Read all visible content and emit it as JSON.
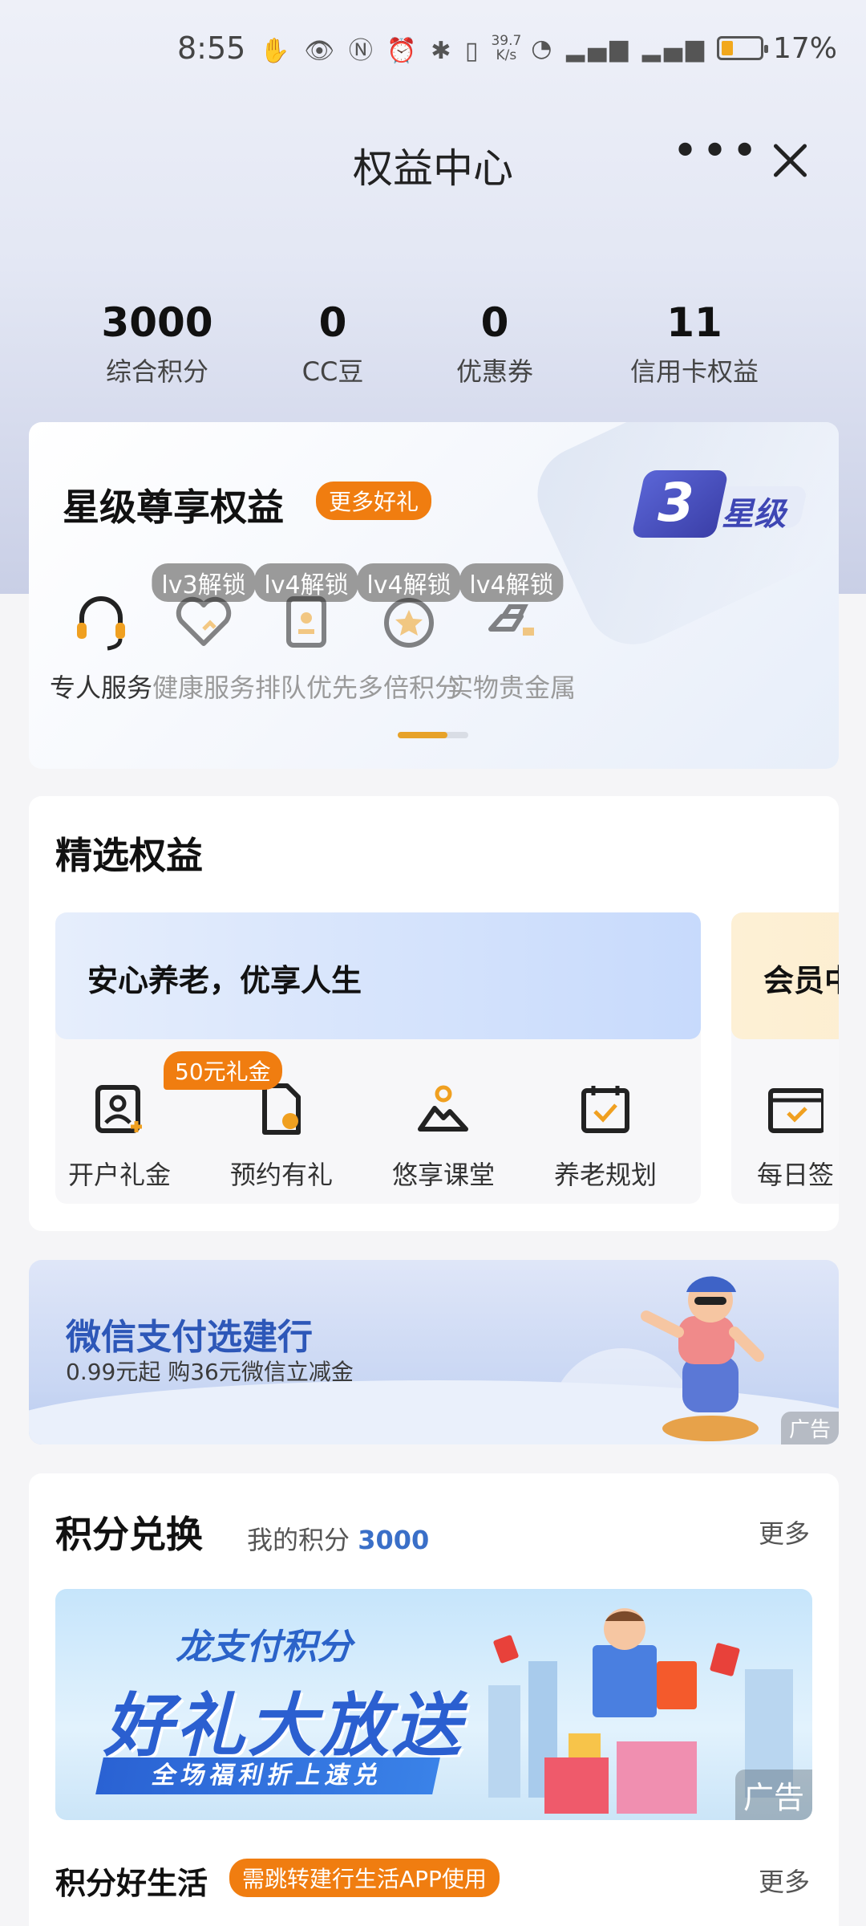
{
  "status_bar": {
    "time": "8:55",
    "net_speed_top": "39.7",
    "net_speed_bottom": "K/s",
    "battery": "17%",
    "battery_level": 0.17
  },
  "nav": {
    "title": "权益中心",
    "more": "•••"
  },
  "stats": [
    {
      "value": "3000",
      "label": "综合积分"
    },
    {
      "value": "0",
      "label": "CC豆"
    },
    {
      "value": "0",
      "label": "优惠券"
    },
    {
      "value": "11",
      "label": "信用卡权益"
    }
  ],
  "star": {
    "title": "星级尊享权益",
    "more_tag": "更多好礼",
    "level_num": "3",
    "level_text": "星级",
    "benefits": [
      {
        "label": "专人服务",
        "lock": ""
      },
      {
        "label": "健康服务",
        "lock": "lv3解锁"
      },
      {
        "label": "排队优先",
        "lock": "lv4解锁"
      },
      {
        "label": "多倍积分",
        "lock": "lv4解锁"
      },
      {
        "label": "实物贵金属",
        "lock": "lv4解锁"
      }
    ]
  },
  "featured": {
    "title": "精选权益",
    "panel1": {
      "heading": "安心养老，优享人生",
      "badge": "50元礼金",
      "items": [
        "开户礼金",
        "预约有礼",
        "悠享课堂",
        "养老规划"
      ]
    },
    "panel2": {
      "heading": "会员中",
      "items": [
        "每日签"
      ]
    }
  },
  "ad_banner": {
    "title": "微信支付选建行",
    "subtitle": "0.99元起 购36元微信立减金",
    "ad_label": "广告"
  },
  "points": {
    "title": "积分兑换",
    "mine_label": "我的积分",
    "mine_value": "3000",
    "more": "更多",
    "banner": {
      "line1": "龙支付积分",
      "line2": "好礼大放送",
      "line3": "全场福利折上速兑",
      "ad_label": "广告"
    },
    "life_title": "积分好生活",
    "life_tag": "需跳转建行生活APP使用",
    "life_more": "更多"
  },
  "colors": {
    "accent_orange": "#f07d10",
    "accent_blue": "#3a6fc8",
    "progress_gold": "#e7a229"
  }
}
